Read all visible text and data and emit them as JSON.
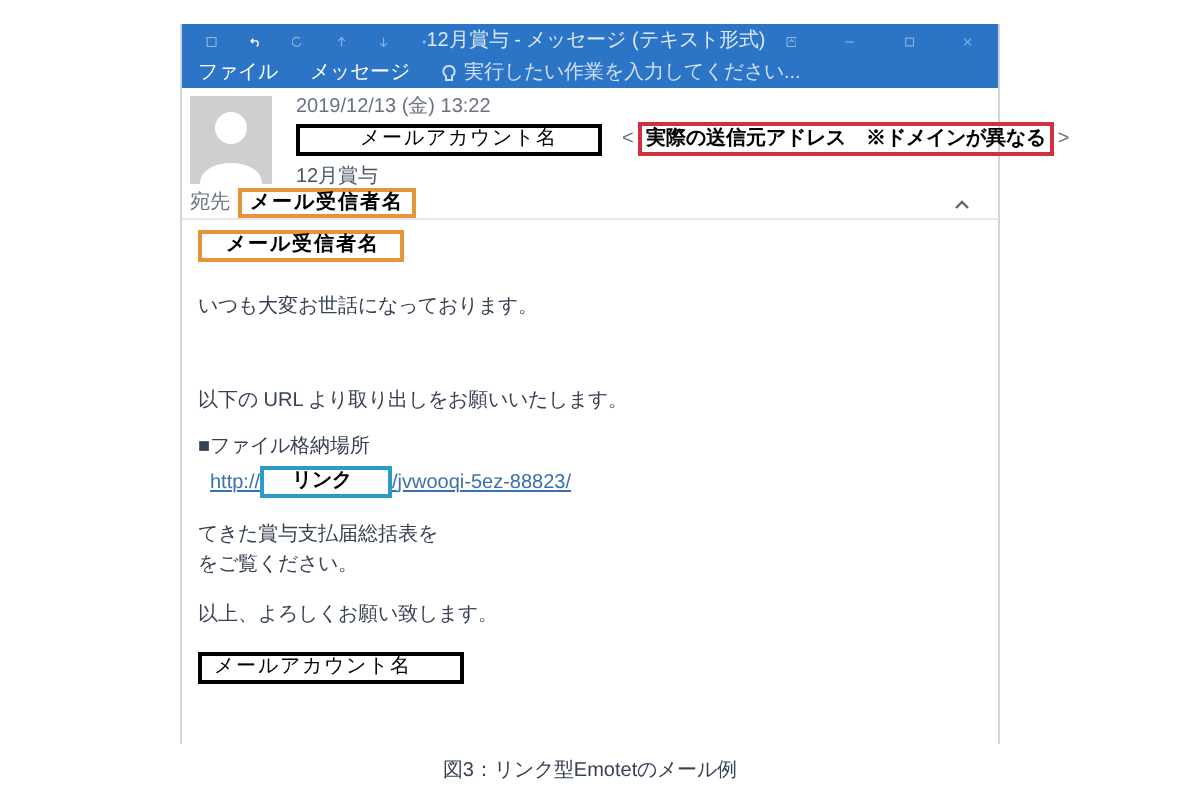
{
  "window": {
    "title": "12月賞与 - メッセージ (テキスト形式)"
  },
  "ribbon": {
    "tabs": [
      {
        "label": "ファイル"
      },
      {
        "label": "メッセージ"
      }
    ],
    "tell_me": {
      "placeholder": "実行したい作業を入力してください..."
    }
  },
  "header": {
    "date": "2019/12/13 (金) 13:22",
    "sender": {
      "text": "メールアカウント名",
      "color": "#000000"
    },
    "address_open": "<",
    "address": {
      "text": "実際の送信元アドレス　※ドメインが異なる",
      "color": "#d03040"
    },
    "address_close": ">",
    "subject": "12月賞与",
    "to_label": "宛先",
    "to": {
      "text": "メール受信者名",
      "color": "#e8923a"
    },
    "expanded": true
  },
  "body": [
    {
      "kind": "annotation",
      "text": "メール受信者名",
      "color": "#e8923a"
    },
    {
      "kind": "line",
      "text": "いつも大変お世話になっております。"
    },
    {
      "kind": "line",
      "text": "以下の URL より取り出しをお願いいたします。"
    },
    {
      "kind": "line",
      "text": "■ファイル格納場所"
    },
    {
      "kind": "link",
      "prefix": "http://",
      "masked": {
        "text": "リンク",
        "color": "#2a9cc8"
      },
      "suffix": "/jvwooqi-5ez-88823/"
    },
    {
      "kind": "line",
      "text": "てきた賞与支払届総括表を"
    },
    {
      "kind": "line",
      "text": "をご覧ください。"
    },
    {
      "kind": "line",
      "text": "以上、よろしくお願い致します。"
    },
    {
      "kind": "annotation",
      "text": "メールアカウント名",
      "color": "#000000"
    }
  ],
  "caption": "図3：リンク型Emotetのメール例"
}
